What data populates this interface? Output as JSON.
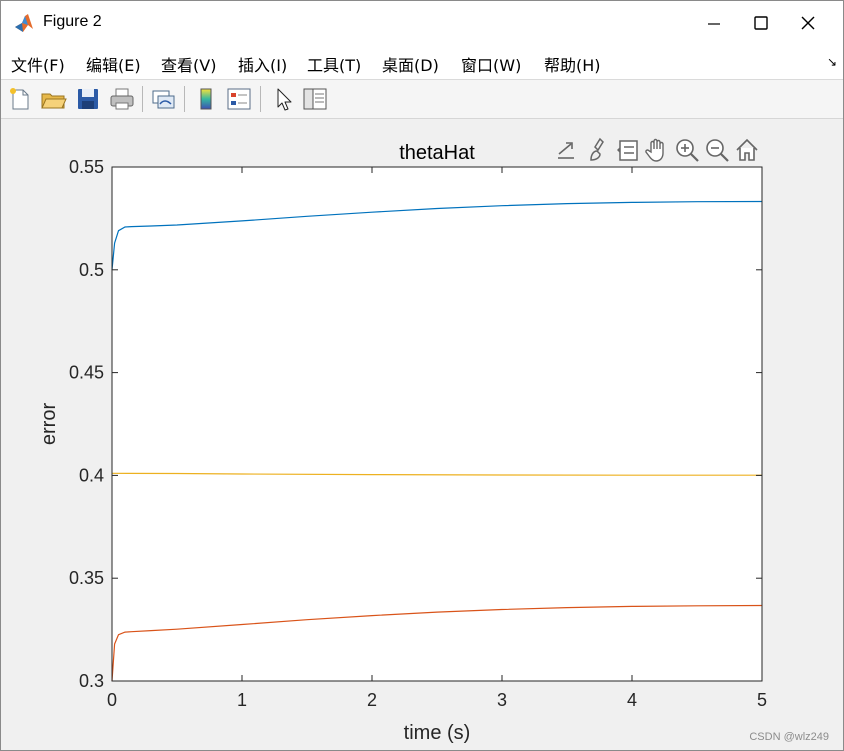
{
  "window": {
    "title": "Figure 2",
    "controls": {
      "minimize": "minimize-icon",
      "maximize": "maximize-icon",
      "close": "close-icon"
    }
  },
  "menu": [
    {
      "label": "文件(F)"
    },
    {
      "label": "编辑(E)"
    },
    {
      "label": "查看(V)"
    },
    {
      "label": "插入(I)"
    },
    {
      "label": "工具(T)"
    },
    {
      "label": "桌面(D)"
    },
    {
      "label": "窗口(W)"
    },
    {
      "label": "帮助(H)"
    }
  ],
  "toolbar": {
    "buttons": [
      "new-figure-icon",
      "open-file-icon",
      "save-icon",
      "print-icon",
      "link-plot-icon",
      "colorbar-icon",
      "legend-icon",
      "edit-plot-arrow-icon",
      "property-inspector-icon"
    ]
  },
  "axes_toolbar": {
    "buttons": [
      "export-icon",
      "brush-icon",
      "data-tips-icon",
      "pan-icon",
      "zoom-in-icon",
      "zoom-out-icon",
      "home-icon"
    ]
  },
  "chart_data": {
    "type": "line",
    "title": "thetaHat",
    "xlabel": "time (s)",
    "ylabel": "error",
    "xlim": [
      0,
      5
    ],
    "ylim": [
      0.3,
      0.55
    ],
    "xticks": [
      "0",
      "1",
      "2",
      "3",
      "4",
      "5"
    ],
    "yticks": [
      "0.3",
      "0.35",
      "0.4",
      "0.45",
      "0.5",
      "0.55"
    ],
    "grid": false,
    "series": [
      {
        "color": "#0072BD",
        "x": [
          0,
          0.02,
          0.05,
          0.1,
          0.15,
          0.3,
          0.5,
          1.0,
          1.5,
          2.0,
          2.5,
          3.0,
          3.5,
          4.0,
          4.5,
          5.0
        ],
        "y": [
          0.5,
          0.513,
          0.519,
          0.5208,
          0.521,
          0.5213,
          0.5218,
          0.5238,
          0.526,
          0.528,
          0.5298,
          0.5312,
          0.5322,
          0.5328,
          0.5331,
          0.5332
        ]
      },
      {
        "color": "#D95319",
        "x": [
          0,
          0.02,
          0.05,
          0.1,
          0.15,
          0.3,
          0.5,
          1.0,
          1.5,
          2.0,
          2.5,
          3.0,
          3.5,
          4.0,
          4.5,
          5.0
        ],
        "y": [
          0.3,
          0.318,
          0.3225,
          0.3238,
          0.324,
          0.3245,
          0.3252,
          0.3275,
          0.3298,
          0.3318,
          0.3335,
          0.3348,
          0.3357,
          0.3363,
          0.3366,
          0.3367
        ]
      },
      {
        "color": "#EDB120",
        "x": [
          0,
          0.5,
          1.0,
          2.0,
          3.0,
          4.0,
          5.0
        ],
        "y": [
          0.401,
          0.4009,
          0.4007,
          0.4004,
          0.4002,
          0.4001,
          0.4001
        ]
      }
    ]
  },
  "watermark": "CSDN @wlz249"
}
